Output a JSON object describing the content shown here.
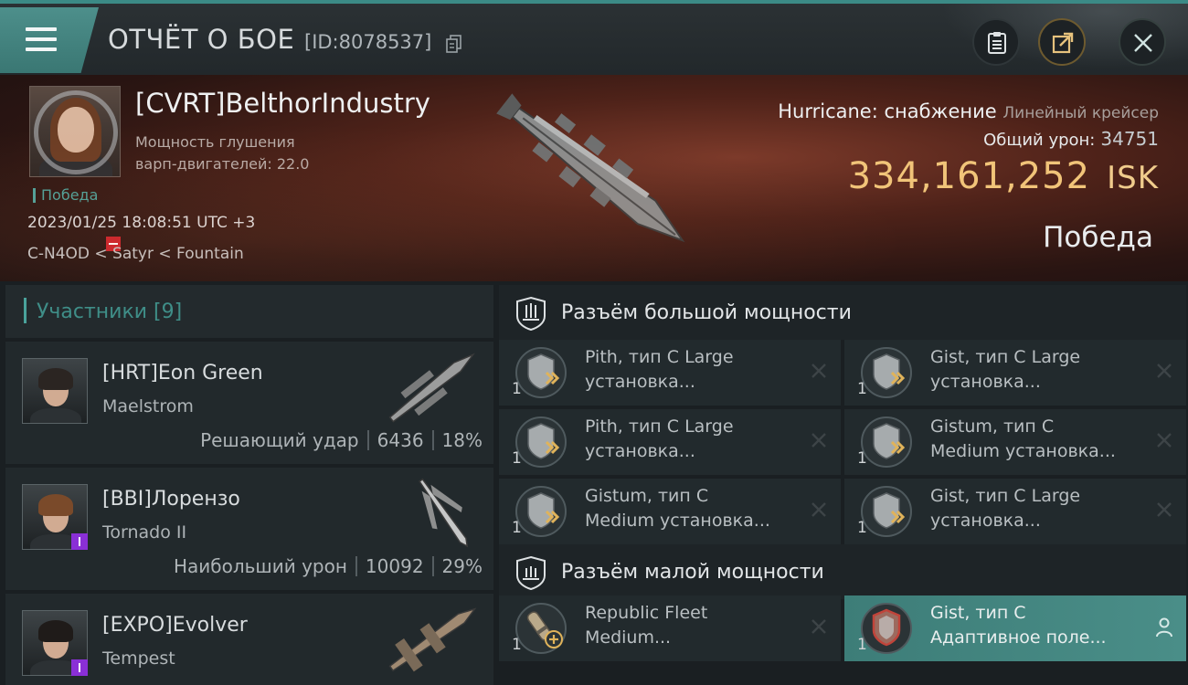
{
  "header": {
    "title": "ОТЧЁТ О БОЕ",
    "report_id": "[ID:8078537]",
    "buttons": {
      "menu": "menu-icon",
      "report": "clipboard-icon",
      "share": "share-icon",
      "close": "close-icon"
    }
  },
  "banner": {
    "pilot_name": "[CVRT]BelthorIndustry",
    "pilot_stat_line1": "Мощность глушения",
    "pilot_stat_line2": "варп-двигателей: 22.0",
    "result_tag": "Победа",
    "datetime": "2023/01/25 18:08:51 UTC +3",
    "location": "C-N4OD < Satyr < Fountain",
    "victim_ship": "Hurricane: снабжение",
    "victim_class": "Линейный крейсер",
    "total_damage_label": "Общий урон:",
    "total_damage_value": "34751",
    "isk_value": "334,161,252",
    "isk_unit": "ISK",
    "outcome": "Победа"
  },
  "participants": {
    "header": "Участники [9]",
    "items": [
      {
        "name": "[HRT]Eon Green",
        "ship": "Maelstrom",
        "role": "Решающий удар",
        "damage": "6436",
        "percent": "18%"
      },
      {
        "name": "[BBI]Лорензо",
        "ship": "Tornado II",
        "role": "Наибольший урон",
        "damage": "10092",
        "percent": "29%"
      },
      {
        "name": "[EXPO]Evolver",
        "ship": "Tempest",
        "role": "",
        "damage": "",
        "percent": ""
      }
    ]
  },
  "fittings": {
    "high_slots": {
      "label": "Разъём большой мощности",
      "modules": [
        {
          "line1": "Pith, тип C Large",
          "line2": "установка...",
          "qty": "1"
        },
        {
          "line1": "Gist, тип C Large",
          "line2": "установка...",
          "qty": "1"
        },
        {
          "line1": "Pith, тип C Large",
          "line2": "установка...",
          "qty": "1"
        },
        {
          "line1": "Gistum, тип C",
          "line2": "Medium установка...",
          "qty": "1"
        },
        {
          "line1": "Gistum, тип C",
          "line2": "Medium установка...",
          "qty": "1"
        },
        {
          "line1": "Gist, тип C Large",
          "line2": "установка...",
          "qty": "1"
        }
      ]
    },
    "low_slots": {
      "label": "Разъём малой мощности",
      "modules": [
        {
          "line1": "Republic Fleet",
          "line2": "Medium...",
          "qty": "1"
        },
        {
          "line1": "Gist, тип C",
          "line2": "Адаптивное поле...",
          "qty": "1"
        }
      ]
    }
  },
  "colors": {
    "accent": "#4aa39c",
    "isk": "#f1c479",
    "menu": "#4d8f8b"
  }
}
